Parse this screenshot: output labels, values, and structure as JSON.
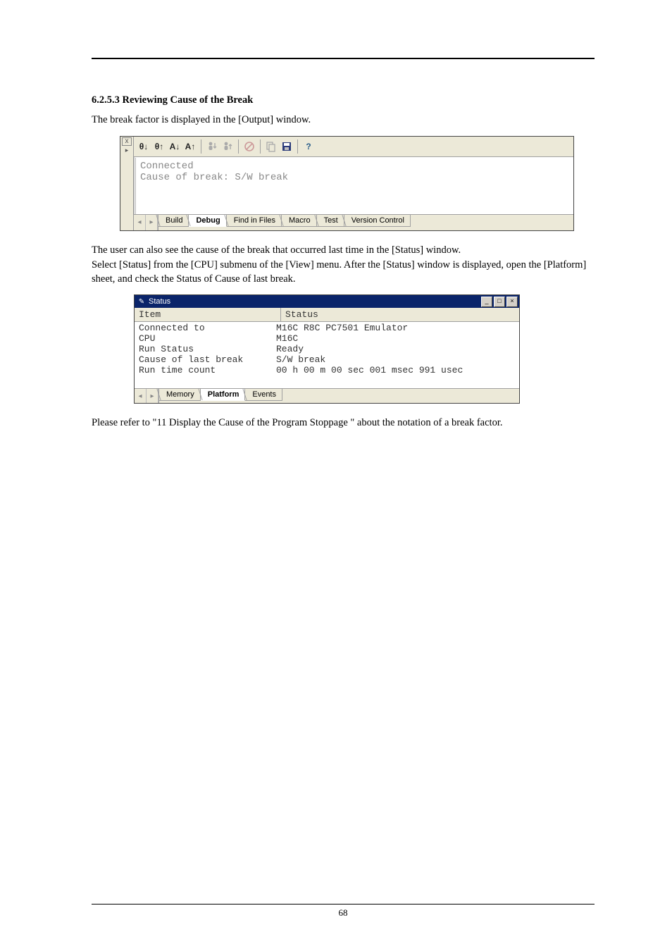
{
  "section": {
    "number": "6.2.5.3",
    "title": "Reviewing Cause of the Break"
  },
  "para1": "The break factor is displayed in the [Output] window.",
  "output_window": {
    "toolbar": {
      "theta_down": "θ↓",
      "theta_up": "θ↑",
      "a_down": "A↓",
      "a_up": "A↑",
      "person_down": "↓",
      "person_up": "↑",
      "redcircle": "",
      "copy": "",
      "save": "",
      "help": "?"
    },
    "body": {
      "line1": "Connected",
      "line2": "Cause of break: S/W break"
    },
    "tabs": {
      "t1": "Build",
      "t2": "Debug",
      "t3": "Find in Files",
      "t4": "Macro",
      "t5": "Test",
      "t6": "Version Control"
    }
  },
  "para2a": "The user can also see the cause of the break that occurred last time in the [Status] window.",
  "para2b": "Select [Status] from the [CPU] submenu of the [View] menu. After the [Status] window is displayed, open the [Platform] sheet, and check the Status of Cause of last break.",
  "status_window": {
    "title": "Status",
    "headers": {
      "col1": "Item",
      "col2": "Status"
    },
    "rows": {
      "r1": {
        "item": "Connected to",
        "status": "M16C R8C PC7501 Emulator"
      },
      "r2": {
        "item": "CPU",
        "status": "M16C"
      },
      "r3": {
        "item": "Run Status",
        "status": "Ready"
      },
      "r4": {
        "item": "Cause of last break",
        "status": "S/W break"
      },
      "r5": {
        "item": "Run time count",
        "status": "00 h 00 m 00 sec 001 msec 991 usec"
      }
    },
    "tabs": {
      "t1": "Memory",
      "t2": "Platform",
      "t3": "Events"
    }
  },
  "para3": "Please refer to \"11 Display the Cause of the Program Stoppage \" about the notation of a break factor.",
  "footer": {
    "page": "68"
  }
}
